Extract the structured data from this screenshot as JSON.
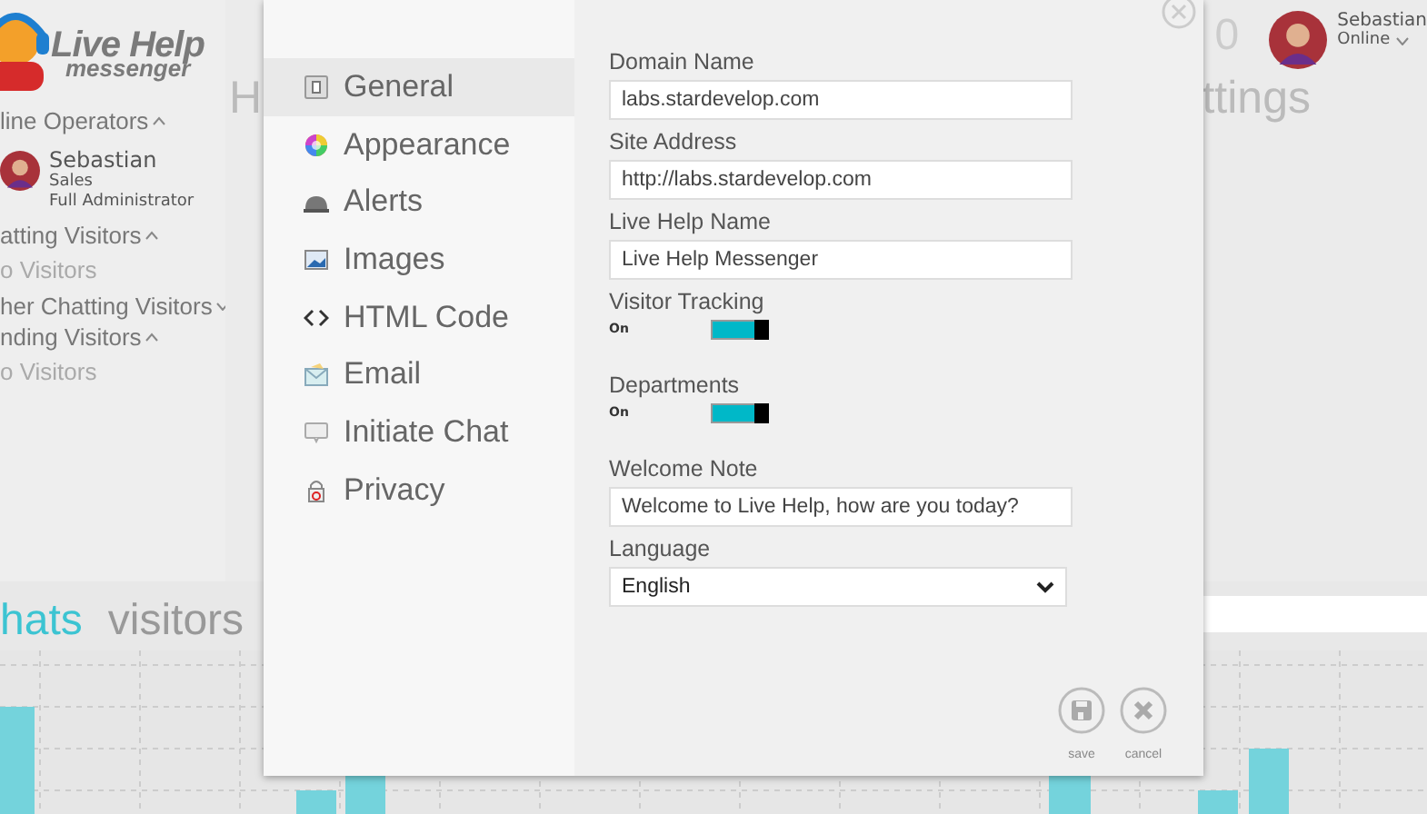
{
  "logo": {
    "title": "Live Help",
    "subtitle": "messenger"
  },
  "sidebar": {
    "sections": [
      {
        "title": "line Operators",
        "expanded": true,
        "operators": [
          {
            "name": "Sebastian",
            "department": "Sales",
            "role": "Full Administrator"
          }
        ]
      },
      {
        "title": "atting Visitors",
        "expanded": true,
        "empty_text": "o Visitors"
      },
      {
        "title": "her Chatting Visitors",
        "expanded": false
      },
      {
        "title": "nding Visitors",
        "expanded": true,
        "empty_text": "o Visitors"
      }
    ]
  },
  "header": {
    "heading_left": "H",
    "count": "0",
    "heading_right": "ttings",
    "user": {
      "name": "Sebastian",
      "status": "Online"
    }
  },
  "tabs": [
    {
      "label": "hats",
      "selected": true
    },
    {
      "label": "visitors",
      "selected": false
    }
  ],
  "dialog": {
    "nav": [
      {
        "label": "General",
        "selected": true
      },
      {
        "label": "Appearance",
        "selected": false
      },
      {
        "label": "Alerts",
        "selected": false
      },
      {
        "label": "Images",
        "selected": false
      },
      {
        "label": "HTML Code",
        "selected": false
      },
      {
        "label": "Email",
        "selected": false
      },
      {
        "label": "Initiate Chat",
        "selected": false
      },
      {
        "label": "Privacy",
        "selected": false
      }
    ],
    "fields": [
      {
        "kind": "text",
        "label": "Domain Name",
        "value": "labs.stardevelop.com"
      },
      {
        "kind": "text",
        "label": "Site Address",
        "value": "http://labs.stardevelop.com"
      },
      {
        "kind": "text",
        "label": "Live Help Name",
        "value": "Live Help Messenger"
      },
      {
        "kind": "toggle",
        "label": "Visitor Tracking",
        "state_text": "On",
        "on": true
      },
      {
        "kind": "toggle",
        "label": "Departments",
        "state_text": "On",
        "on": true
      },
      {
        "kind": "text",
        "label": "Welcome Note",
        "value": "Welcome to Live Help, how are you today?"
      },
      {
        "kind": "select",
        "label": "Language",
        "value": "English"
      }
    ],
    "buttons": [
      {
        "kind": "save",
        "label": "save"
      },
      {
        "kind": "cancel",
        "label": "cancel"
      }
    ]
  }
}
